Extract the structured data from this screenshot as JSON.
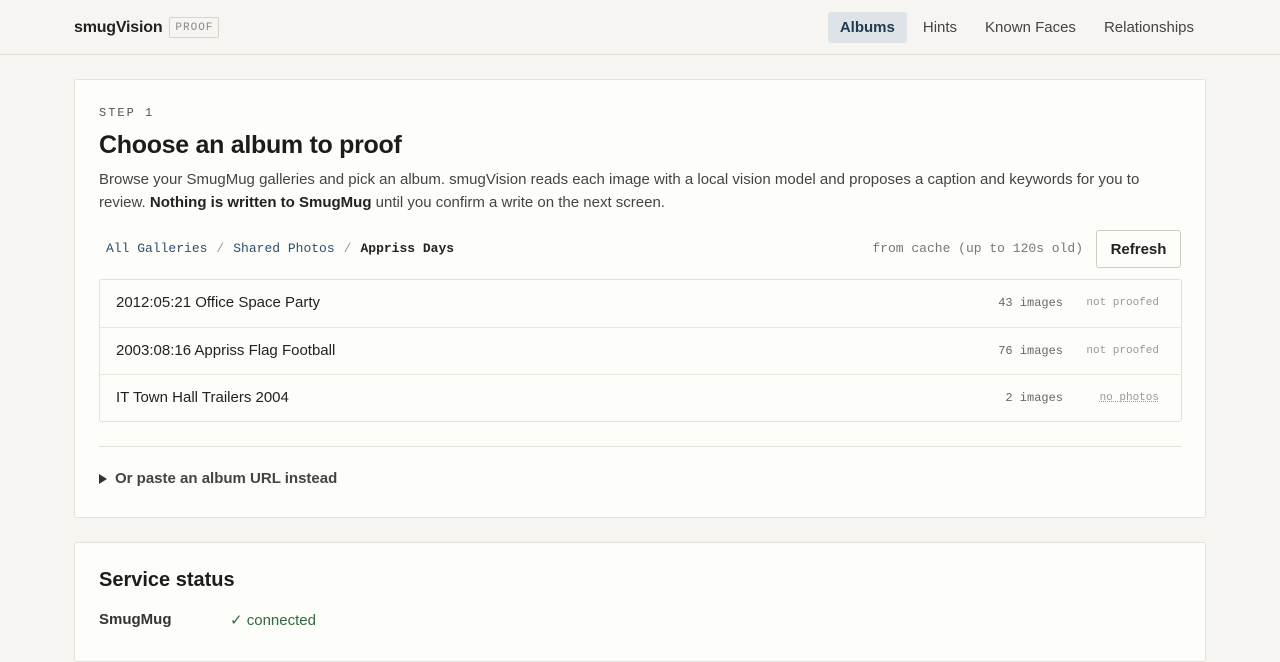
{
  "app": {
    "name": "smugVision",
    "badge": "PROOF"
  },
  "nav": {
    "items": [
      {
        "label": "Albums",
        "active": true
      },
      {
        "label": "Hints",
        "active": false
      },
      {
        "label": "Known Faces",
        "active": false
      },
      {
        "label": "Relationships",
        "active": false
      }
    ]
  },
  "step_card": {
    "step_label": "STEP 1",
    "title": "Choose an album to proof",
    "desc_part1": "Browse your SmugMug galleries and pick an album. smugVision reads each image with a local vision model and proposes a caption and keywords for you to review. ",
    "desc_bold": "Nothing is written to SmugMug",
    "desc_part2": " until you confirm a write on the next screen.",
    "breadcrumb": [
      "All Galleries",
      "Shared Photos",
      "Appriss Days"
    ],
    "breadcrumb_sep": "/",
    "cache_note": "from cache (up to 120s old)",
    "refresh_label": "Refresh",
    "albums": [
      {
        "name": "2012:05:21 Office Space Party",
        "count": "43 images",
        "status": "not proofed"
      },
      {
        "name": "2003:08:16 Appriss Flag Football",
        "count": "76 images",
        "status": "not proofed"
      },
      {
        "name": "IT Town Hall Trailers 2004",
        "count": "2 images",
        "status": "no photos"
      }
    ],
    "paste_toggle": "Or paste an album URL instead"
  },
  "service_status": {
    "title": "Service status",
    "services": [
      {
        "name": "SmugMug",
        "status": "✓ connected",
        "color": "#2f6a3a"
      }
    ]
  },
  "colors": {
    "background": "#f6f5f1",
    "accent": "#1f3b52",
    "nav_active_bg": "#dde3e6",
    "link": "#2b4f6e"
  }
}
